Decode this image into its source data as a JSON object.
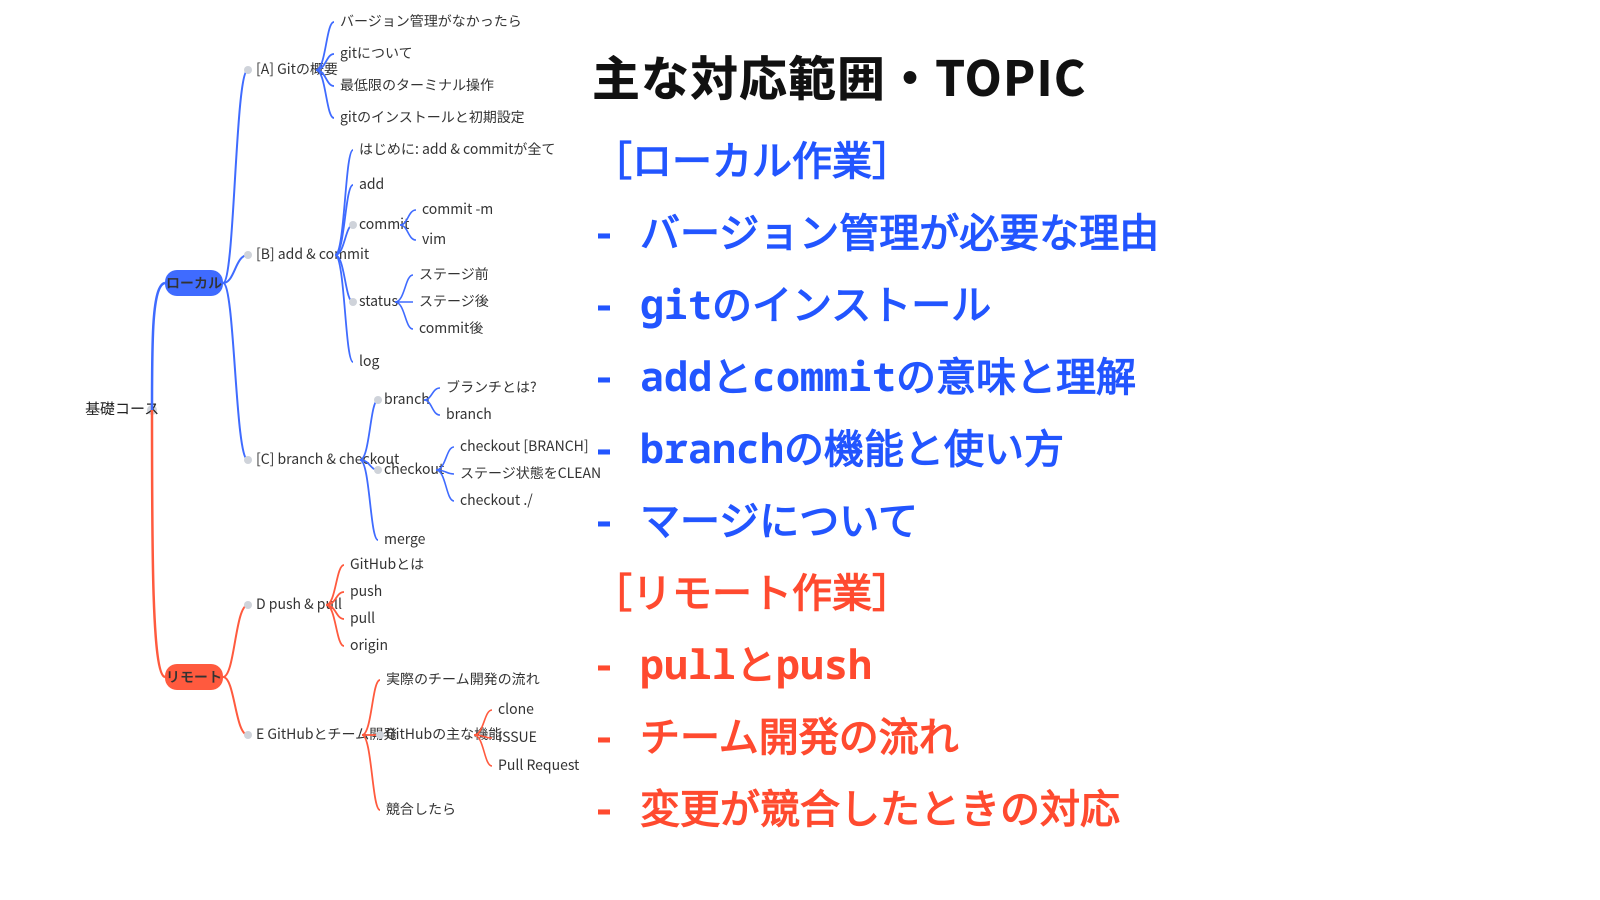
{
  "colors": {
    "blue": "#3f6bff",
    "red": "#ff5a3e",
    "grayNode": "#cfd3da",
    "text": "#333"
  },
  "mindmap": {
    "root": "基礎コース",
    "local": {
      "label": "ローカル",
      "sections": {
        "A": {
          "label": "[A] Gitの概要",
          "children": [
            "バージョン管理がなかったら",
            "gitについて",
            "最低限のターミナル操作",
            "gitのインストールと初期設定"
          ]
        },
        "B": {
          "label": "[B] add & commit",
          "children": {
            "first": "はじめに: add & commitが全て",
            "add": "add",
            "commit": {
              "label": "commit",
              "children": [
                "commit -m",
                "vim"
              ]
            },
            "status": {
              "label": "status",
              "children": [
                "ステージ前",
                "ステージ後",
                "commit後"
              ]
            },
            "log": "log"
          }
        },
        "C": {
          "label": "[C] branch & checkout",
          "children": {
            "branch": {
              "label": "branch",
              "children": [
                "ブランチとは?",
                "branch"
              ]
            },
            "checkout": {
              "label": "checkout",
              "children": [
                "checkout [BRANCH]",
                "ステージ状態をCLEANにする",
                "checkout ./"
              ]
            },
            "merge": "merge"
          }
        }
      }
    },
    "remote": {
      "label": "リモート",
      "sections": {
        "D": {
          "label": "D push & pull",
          "children": [
            "GitHubとは",
            "push",
            "pull",
            "origin"
          ]
        },
        "E": {
          "label": "E GitHubとチーム開発",
          "children": {
            "flow": "実際のチーム開発の流れ",
            "main": {
              "label": "GitHubの主な機能",
              "children": [
                "clone",
                "ISSUE",
                "Pull Request"
              ]
            },
            "conflict": "競合したら"
          }
        }
      }
    }
  },
  "topics": {
    "title": "主な対応範囲・TOPIC",
    "local": {
      "header": "［ローカル作業］",
      "items": [
        "- バージョン管理が必要な理由",
        "- gitのインストール",
        "- addとcommitの意味と理解",
        "- branchの機能と使い方",
        "- マージについて"
      ]
    },
    "remote": {
      "header": "［リモート作業］",
      "items": [
        "- pullとpush",
        "- チーム開発の流れ",
        "- 変更が競合したときの対応"
      ]
    }
  }
}
